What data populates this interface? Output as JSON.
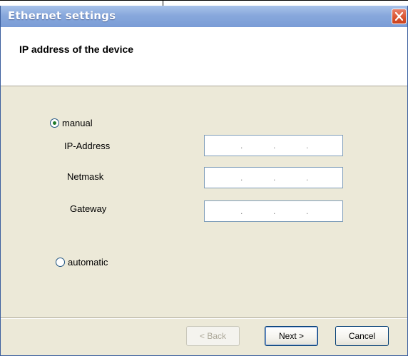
{
  "window": {
    "title": "Ethernet settings",
    "close_icon": "close-icon"
  },
  "header": {
    "title": "IP address of the device"
  },
  "mode": {
    "manual_label": "manual",
    "automatic_label": "automatic",
    "selected": "manual"
  },
  "fields": {
    "ip_label": "IP-Address",
    "netmask_label": "Netmask",
    "gateway_label": "Gateway",
    "ip_value": ".       .       .",
    "netmask_value": ".       .       .",
    "gateway_value": ".       .       ."
  },
  "buttons": {
    "back_label": "< Back",
    "next_label": "Next >",
    "cancel_label": "Cancel"
  },
  "colors": {
    "title_gradient_top": "#a8c2ea",
    "title_gradient_bottom": "#7a9cd6",
    "close_red": "#d9532f",
    "dialog_bg": "#ece9d8",
    "radio_dot": "#1f7a29"
  }
}
